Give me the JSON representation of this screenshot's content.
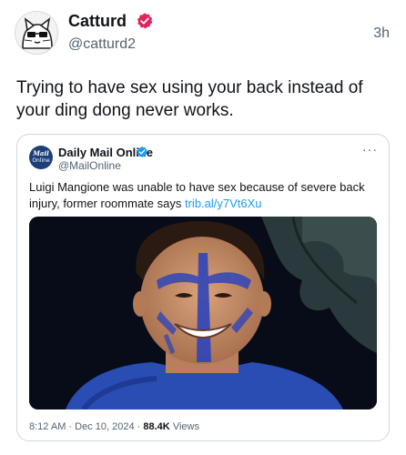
{
  "post": {
    "author_name": "Catturd",
    "handle": "@catturd2",
    "timestamp": "3h",
    "text": "Trying to have sex using your back instead of your ding dong never works."
  },
  "quoted_post": {
    "avatar_line1": "Mail",
    "avatar_line2": "Online",
    "author_name": "Daily Mail Online",
    "handle": "@MailOnline",
    "more_label": "···",
    "text": "Luigi Mangione was unable to have sex because of severe back injury, former roommate says",
    "link_text": "trib.al/y7Vt6Xu",
    "time": "8:12 AM",
    "date": "Dec 10, 2024",
    "separator": "·",
    "views_count": "88.4K",
    "views_label": "Views"
  },
  "colors": {
    "verified_badge": "#e0245e",
    "quote_verified_badge": "#1d9bf0",
    "link": "#1d9bf0",
    "secondary_text": "#536471",
    "face_paint": "#2f45b8"
  },
  "icons": {
    "avatar": "cartoon-cat-icon",
    "verified": "verified-badge-icon",
    "more": "more-options-icon"
  }
}
